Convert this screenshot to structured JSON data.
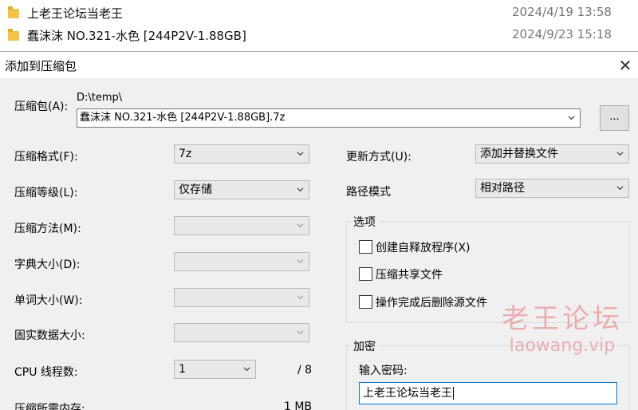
{
  "explorer": {
    "files": [
      {
        "name": "上老王论坛当老王",
        "date": "2024/4/19 13:58"
      },
      {
        "name": "蠢沫沫 NO.321-水色 [244P2V-1.88GB]",
        "date": "2024/9/23 15:18"
      }
    ]
  },
  "dialog": {
    "title": "添加到压缩包",
    "close_icon": "✕",
    "archive": {
      "label": "压缩包(A):",
      "path": "D:\\temp\\",
      "filename": "蠢沫沫 NO.321-水色 [244P2V-1.88GB].7z",
      "browse_label": "..."
    },
    "left": {
      "format_label": "压缩格式(F):",
      "format_value": "7z",
      "level_label": "压缩等级(L):",
      "level_value": "仅存储",
      "method_label": "压缩方法(M):",
      "dict_label": "字典大小(D):",
      "word_label": "单词大小(W):",
      "solid_label": "固实数据大小:",
      "cpu_label": "CPU 线程数:",
      "cpu_value": "1",
      "cpu_total": "/ 8",
      "memory_label": "压缩所需内存:",
      "memory_value": "1 MB"
    },
    "right": {
      "update_label": "更新方式(U):",
      "update_value": "添加并替换文件",
      "path_mode_label": "路径模式",
      "path_mode_value": "相对路径",
      "options_title": "选项",
      "options": [
        "创建自释放程序(X)",
        "压缩共享文件",
        "操作完成后删除源文件"
      ],
      "encryption_title": "加密",
      "password_label": "输入密码:",
      "password_value": "上老王论坛当老王"
    }
  },
  "watermark": {
    "cn": "老王论坛",
    "en": "laowang.vip"
  },
  "colors": {
    "folder": "#f3c343",
    "focus_border": "#0078d7",
    "watermark": "#e6787d"
  }
}
